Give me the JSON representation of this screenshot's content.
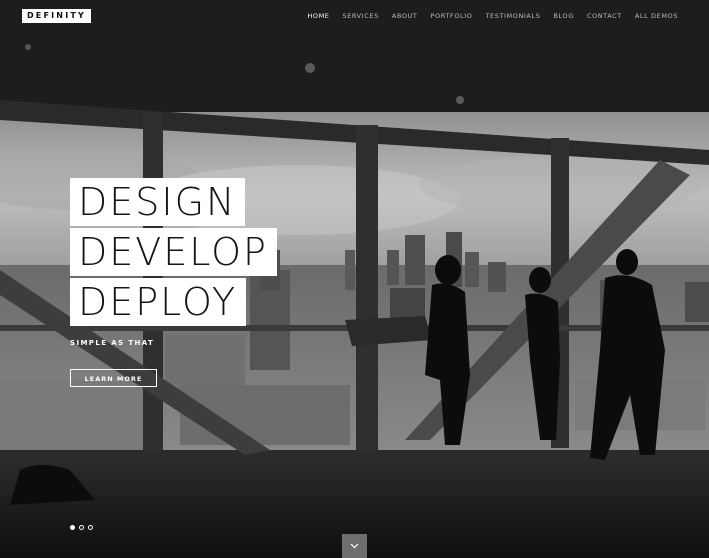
{
  "header": {
    "logo": "DEFINITY",
    "nav": [
      {
        "label": "HOME",
        "active": true
      },
      {
        "label": "SERVICES",
        "active": false
      },
      {
        "label": "ABOUT",
        "active": false
      },
      {
        "label": "PORTFOLIO",
        "active": false
      },
      {
        "label": "TESTIMONIALS",
        "active": false
      },
      {
        "label": "BLOG",
        "active": false
      },
      {
        "label": "CONTACT",
        "active": false
      },
      {
        "label": "ALL DEMOS",
        "active": false
      }
    ]
  },
  "hero": {
    "headline_lines": [
      "DESIGN",
      "DEVELOP",
      "DEPLOY"
    ],
    "subtitle": "SIMPLE AS THAT",
    "cta_label": "LEARN MORE",
    "slides": 3,
    "active_slide": 1
  },
  "icons": {
    "scroll": "chevron-down-icon"
  },
  "colors": {
    "background": "#1a1a1a",
    "text_light": "#ffffff",
    "nav_inactive": "#bdbdbd",
    "headline_box": "#ffffff",
    "headline_text": "#151515"
  }
}
